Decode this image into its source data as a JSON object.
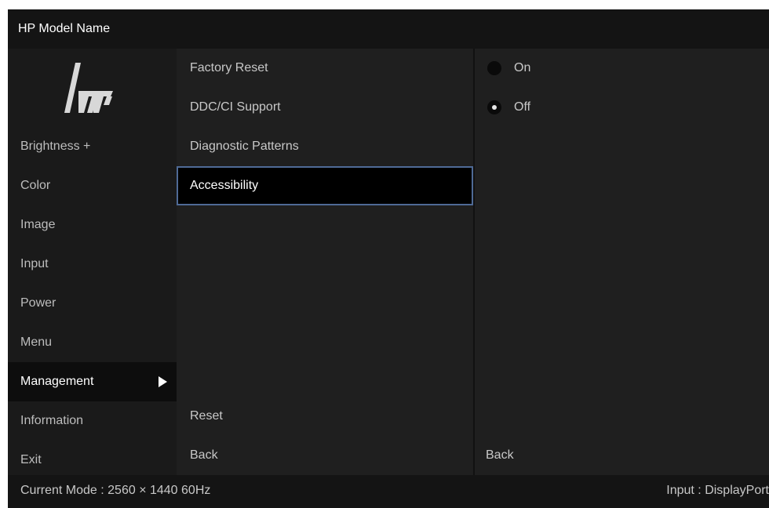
{
  "header": {
    "title": "HP Model Name"
  },
  "sidebar": {
    "logo": "hp-logo",
    "items": [
      {
        "label": "Brightness +"
      },
      {
        "label": "Color"
      },
      {
        "label": "Image"
      },
      {
        "label": "Input"
      },
      {
        "label": "Power"
      },
      {
        "label": "Menu"
      },
      {
        "label": "Management",
        "active": true,
        "icon": "arrow-right-icon"
      },
      {
        "label": "Information"
      },
      {
        "label": "Exit"
      }
    ]
  },
  "submenu": {
    "items": [
      {
        "label": "Factory Reset"
      },
      {
        "label": "DDC/CI Support"
      },
      {
        "label": "Diagnostic Patterns"
      },
      {
        "label": "Accessibility",
        "selected": true
      }
    ],
    "reset_label": "Reset",
    "back_label": "Back"
  },
  "options": {
    "items": [
      {
        "label": "On",
        "checked": false
      },
      {
        "label": "Off",
        "checked": true
      }
    ],
    "back_label": "Back"
  },
  "status": {
    "current_mode": "Current Mode : 2560 × 1440  60Hz",
    "input": "Input : DisplayPort"
  },
  "colors": {
    "selection_border": "#4f6a96",
    "background": "#1f1f1f"
  }
}
